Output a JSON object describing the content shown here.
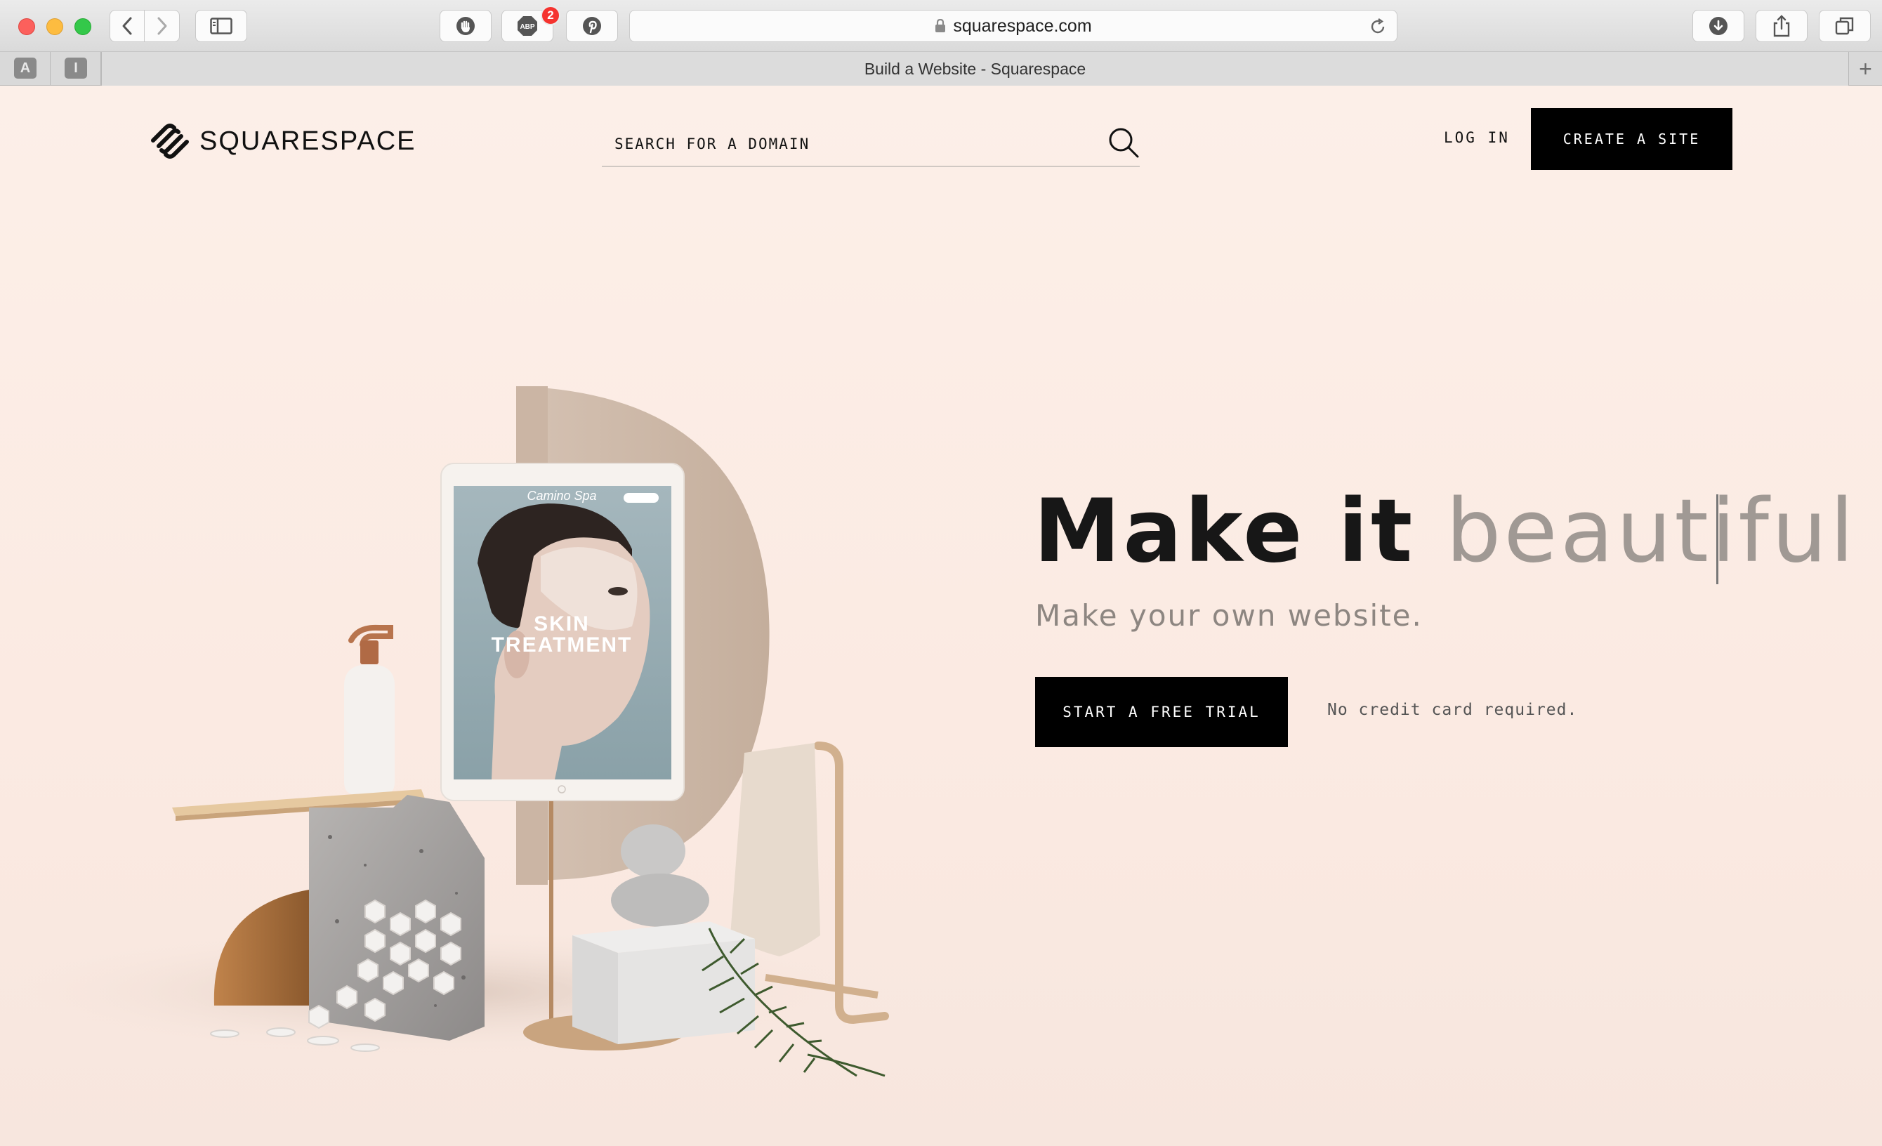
{
  "browser": {
    "url": "squarespace.com",
    "tab_title": "Build a Website - Squarespace",
    "abp_label": "ABP",
    "abp_badge": "2",
    "pinned_tabs": [
      "A",
      "I"
    ],
    "new_tab": "+"
  },
  "header": {
    "logo_text": "SQUARESPACE",
    "search_placeholder": "SEARCH FOR A DOMAIN",
    "login_label": "LOG IN",
    "create_label": "CREATE A SITE"
  },
  "hero": {
    "title_part1": "Make it",
    "title_part2": "beautiful",
    "subtitle": "Make your own website.",
    "cta_label": "START A FREE TRIAL",
    "cta_note": "No credit card required."
  },
  "tablet": {
    "brand": "Camino Spa",
    "headline_line1": "SKIN",
    "headline_line2": "TREATMENT"
  },
  "colors": {
    "page_bg": "#fcefe8",
    "button_bg": "#000000",
    "title_dark": "#171717",
    "title_light": "#a09994"
  }
}
